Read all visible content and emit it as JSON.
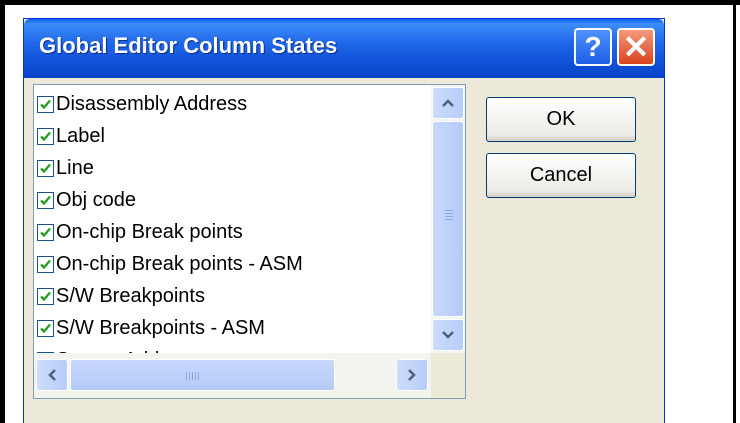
{
  "window": {
    "title": "Global Editor Column States",
    "help_icon": "?",
    "close_icon": "✕"
  },
  "list": {
    "items": [
      {
        "label": "Disassembly Address",
        "checked": true
      },
      {
        "label": "Label",
        "checked": true
      },
      {
        "label": "Line",
        "checked": true
      },
      {
        "label": "Obj code",
        "checked": true
      },
      {
        "label": "On-chip Break points",
        "checked": true
      },
      {
        "label": "On-chip Break points - ASM",
        "checked": true
      },
      {
        "label": "S/W Breakpoints",
        "checked": true
      },
      {
        "label": "S/W Breakpoints - ASM",
        "checked": true
      },
      {
        "label": "Source Address",
        "checked": true
      }
    ]
  },
  "buttons": {
    "ok": "OK",
    "cancel": "Cancel"
  },
  "colors": {
    "titlebar": "#0a5ee6",
    "dialog_bg": "#ece9d8",
    "close": "#d9431d"
  }
}
